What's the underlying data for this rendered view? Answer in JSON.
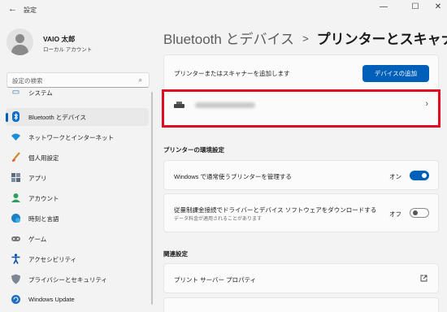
{
  "window": {
    "title": "設定",
    "back_glyph": "←",
    "minimize_glyph": "—",
    "maximize_glyph": "☐",
    "close_glyph": "✕"
  },
  "user": {
    "name": "VAIO 太郎",
    "account_type": "ローカル アカウント"
  },
  "search": {
    "placeholder": "設定の検索",
    "icon": "search-icon"
  },
  "sidebar": {
    "items": [
      {
        "label": "システム",
        "icon": "system-icon"
      },
      {
        "label": "Bluetooth とデバイス",
        "icon": "bluetooth-icon",
        "active": true
      },
      {
        "label": "ネットワークとインターネット",
        "icon": "wifi-icon"
      },
      {
        "label": "個人用設定",
        "icon": "brush-icon"
      },
      {
        "label": "アプリ",
        "icon": "apps-icon"
      },
      {
        "label": "アカウント",
        "icon": "account-icon"
      },
      {
        "label": "時刻と言語",
        "icon": "globe-clock-icon"
      },
      {
        "label": "ゲーム",
        "icon": "gamepad-icon"
      },
      {
        "label": "アクセシビリティ",
        "icon": "accessibility-icon"
      },
      {
        "label": "プライバシーとセキュリティ",
        "icon": "shield-icon"
      },
      {
        "label": "Windows Update",
        "icon": "update-icon"
      }
    ]
  },
  "breadcrumb": {
    "parent": "Bluetooth とデバイス",
    "separator": ">",
    "current": "プリンターとスキャナー"
  },
  "add_device": {
    "text": "プリンターまたはスキャナーを追加します",
    "button_label": "デバイスの追加"
  },
  "printer_entry": {
    "chevron": "›",
    "icon": "printer-icon"
  },
  "printer_settings": {
    "heading": "プリンターの環境設定",
    "manage_default": {
      "label": "Windows で通常使うプリンターを管理する",
      "state_label": "オン",
      "state": true
    },
    "metered_download": {
      "label": "従量制課金接続でドライバーとデバイス ソフトウェアをダウンロードする",
      "sublabel": "データ料金が適用されることがあります",
      "state_label": "オフ",
      "state": false
    }
  },
  "related": {
    "heading": "関連設定",
    "print_server": {
      "label": "プリント サーバー プロパティ",
      "icon": "external-link-icon"
    }
  },
  "colors": {
    "accent": "#005fb8",
    "highlight_border": "#e00b21"
  }
}
